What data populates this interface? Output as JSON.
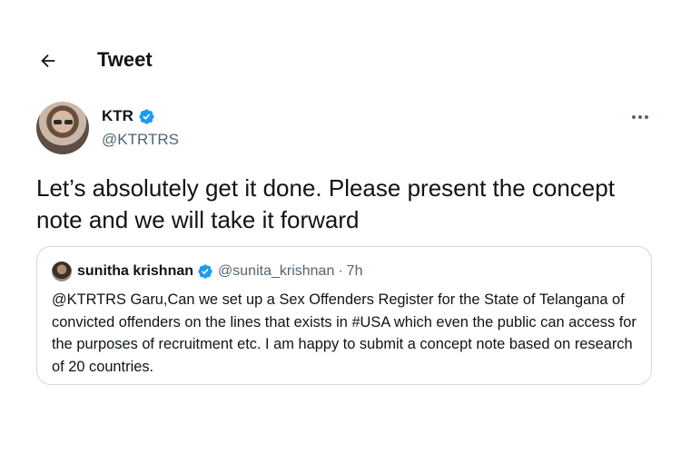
{
  "header": {
    "title": "Tweet",
    "back_icon": "arrow-left-icon"
  },
  "tweet": {
    "author_name": "KTR",
    "author_handle": "@KTRTRS",
    "verified": true,
    "text": "Let’s absolutely get it done. Please present the concept note and we will take it forward",
    "more_icon": "more-dots-icon"
  },
  "quoted_tweet": {
    "author_name": "sunitha krishnan",
    "author_handle": "@sunita_krishnan",
    "separator": "·",
    "time": "7h",
    "verified": true,
    "text": "@KTRTRS Garu,Can we set up a Sex Offenders Register for the State of Telangana of convicted offenders on the lines that exists in #USA which even the public can access for the purposes of recruitment etc. I am happy to submit a concept note based on research of 20 countries."
  },
  "colors": {
    "primary_text": "#0f1419",
    "secondary_text": "#536471",
    "verified_blue": "#1d9bf0",
    "border": "#cfd9de"
  }
}
